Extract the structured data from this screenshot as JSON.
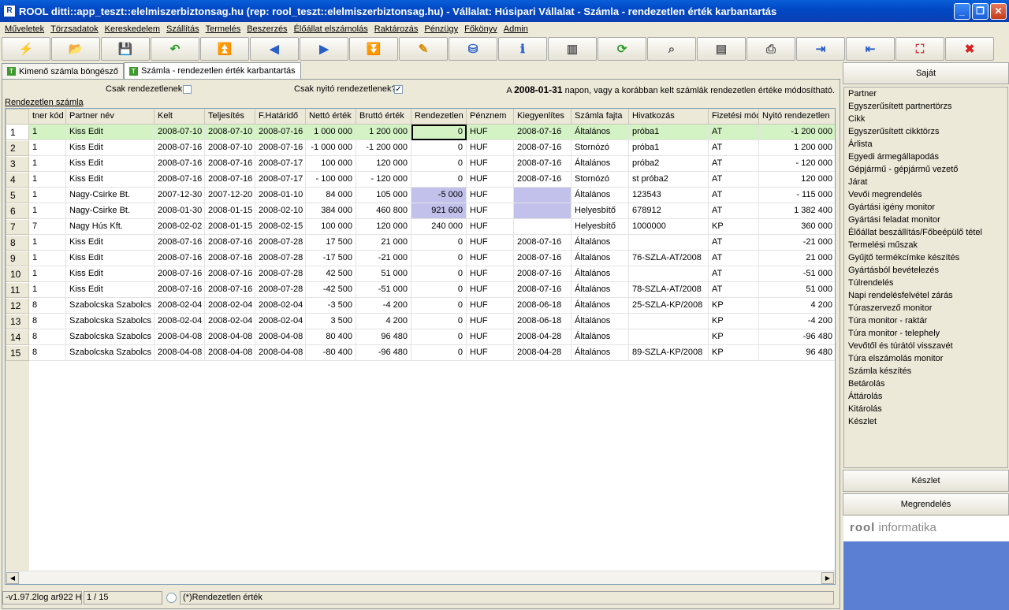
{
  "window": {
    "title": "ROOL ditti::app_teszt::elelmiszerbiztonsag.hu (rep: rool_teszt::elelmiszerbiztonsag.hu) - Vállalat: Húsipari Vállalat - Számla - rendezetlen érték karbantartás",
    "minimize": "_",
    "restore": "❐",
    "close": "✕"
  },
  "menu": [
    "Műveletek",
    "Törzsadatok",
    "Kereskedelem",
    "Szállítás",
    "Termelés",
    "Beszerzés",
    "Élőállat elszámolás",
    "Raktározás",
    "Pénzügy",
    "Főkönyv",
    "Admin"
  ],
  "toolbar": [
    {
      "icon": "lightning-icon",
      "glyph": "⚡",
      "color": "#d8a400"
    },
    {
      "icon": "open-folder-icon",
      "glyph": "📂",
      "color": "#2a5fc8"
    },
    {
      "icon": "save-icon",
      "glyph": "💾",
      "color": "#2a5fc8"
    },
    {
      "icon": "undo-icon",
      "glyph": "↶",
      "color": "#2e9b2e"
    },
    {
      "icon": "first-record-icon",
      "glyph": "⏫",
      "color": "#2a5fc8"
    },
    {
      "icon": "previous-record-icon",
      "glyph": "◀",
      "color": "#2a5fc8"
    },
    {
      "icon": "next-record-icon",
      "glyph": "▶",
      "color": "#2a5fc8"
    },
    {
      "icon": "last-record-icon",
      "glyph": "⏬",
      "color": "#2a5fc8"
    },
    {
      "icon": "edit-icon",
      "glyph": "✎",
      "color": "#d88a00"
    },
    {
      "icon": "database-icon",
      "glyph": "⛁",
      "color": "#2a5fc8"
    },
    {
      "icon": "info-icon",
      "glyph": "ℹ",
      "color": "#2a5fc8"
    },
    {
      "icon": "form-view-icon",
      "glyph": "▥",
      "color": "#555555"
    },
    {
      "icon": "refresh-icon",
      "glyph": "⟳",
      "color": "#2e9b2e"
    },
    {
      "icon": "search-icon",
      "glyph": "⌕",
      "color": "#555555"
    },
    {
      "icon": "columns-icon",
      "glyph": "▤",
      "color": "#555555"
    },
    {
      "icon": "print-icon",
      "glyph": "⎙",
      "color": "#555555"
    },
    {
      "icon": "export-icon",
      "glyph": "⇥",
      "color": "#2a5fc8"
    },
    {
      "icon": "import-icon",
      "glyph": "⇤",
      "color": "#2a5fc8"
    },
    {
      "icon": "fullscreen-icon",
      "glyph": "⛶",
      "color": "#c83232"
    },
    {
      "icon": "cancel-icon",
      "glyph": "✖",
      "color": "#d82020"
    }
  ],
  "tabs": [
    {
      "label": "Kimenő számla böngésző",
      "icon_text": "T"
    },
    {
      "label": "Számla - rendezetlen érték karbantartás",
      "icon_text": "T"
    }
  ],
  "filters": {
    "only_unsettled_label": "Csak rendezetlenek",
    "only_unsettled_checked": false,
    "only_opening_label": "Csak nyitó rendezetlenek?",
    "only_opening_checked": true,
    "notice_prefix": "A",
    "notice_date": "2008-01-31",
    "notice_suffix": "napon, vagy a korábban kelt számlák rendezetlen értéke módosítható."
  },
  "grid_title": "Rendezetlen számla",
  "grid": {
    "columns": [
      "tner kód",
      "Partner név",
      "Kelt",
      "Teljesítés",
      "F.Határidő",
      "Nettó érték",
      "Bruttó érték",
      "Rendezetlen",
      "Pénznem",
      "Kiegyenlítes",
      "Számla fajta",
      "Hivatkozás",
      "Fizetési móc",
      "Nyitó rendezetlen"
    ],
    "rows": [
      [
        "1",
        "Kiss Edit",
        "2008-07-10",
        "2008-07-10",
        "2008-07-16",
        "1 000 000",
        "1 200 000",
        "0",
        "HUF",
        "2008-07-16",
        "Általános",
        "próba1",
        "AT",
        "-1 200 000"
      ],
      [
        "1",
        "Kiss Edit",
        "2008-07-16",
        "2008-07-10",
        "2008-07-16",
        "-1 000 000",
        "-1 200 000",
        "0",
        "HUF",
        "2008-07-16",
        "Stornózó",
        "próba1",
        "AT",
        "1 200 000"
      ],
      [
        "1",
        "Kiss Edit",
        "2008-07-16",
        "2008-07-16",
        "2008-07-17",
        "100 000",
        "120 000",
        "0",
        "HUF",
        "2008-07-16",
        "Általános",
        "próba2",
        "AT",
        "- 120 000"
      ],
      [
        "1",
        "Kiss Edit",
        "2008-07-16",
        "2008-07-16",
        "2008-07-17",
        "- 100 000",
        "- 120 000",
        "0",
        "HUF",
        "2008-07-16",
        "Stornózó",
        "st próba2",
        "AT",
        "120 000"
      ],
      [
        "1",
        "Nagy-Csirke Bt.",
        "2007-12-30",
        "2007-12-20",
        "2008-01-10",
        "84 000",
        "105 000",
        "-5 000",
        "HUF",
        "",
        "Általános",
        "123543",
        "AT",
        "- 115 000"
      ],
      [
        "1",
        "Nagy-Csirke Bt.",
        "2008-01-30",
        "2008-01-15",
        "2008-02-10",
        "384 000",
        "460 800",
        "921 600",
        "HUF",
        "",
        "Helyesbítő",
        "678912",
        "AT",
        "1 382 400"
      ],
      [
        "7",
        "Nagy Hús Kft.",
        "2008-02-02",
        "2008-01-15",
        "2008-02-15",
        "100 000",
        "120 000",
        "240 000",
        "HUF",
        "",
        "Helyesbítő",
        "1000000",
        "KP",
        "360 000"
      ],
      [
        "1",
        "Kiss Edit",
        "2008-07-16",
        "2008-07-16",
        "2008-07-28",
        "17 500",
        "21 000",
        "0",
        "HUF",
        "2008-07-16",
        "Általános",
        "",
        "AT",
        "-21 000"
      ],
      [
        "1",
        "Kiss Edit",
        "2008-07-16",
        "2008-07-16",
        "2008-07-28",
        "-17 500",
        "-21 000",
        "0",
        "HUF",
        "2008-07-16",
        "Általános",
        "76-SZLA-AT/2008",
        "AT",
        "21 000"
      ],
      [
        "1",
        "Kiss Edit",
        "2008-07-16",
        "2008-07-16",
        "2008-07-28",
        "42 500",
        "51 000",
        "0",
        "HUF",
        "2008-07-16",
        "Általános",
        "",
        "AT",
        "-51 000"
      ],
      [
        "1",
        "Kiss Edit",
        "2008-07-16",
        "2008-07-16",
        "2008-07-28",
        "-42 500",
        "-51 000",
        "0",
        "HUF",
        "2008-07-16",
        "Általános",
        "78-SZLA-AT/2008",
        "AT",
        "51 000"
      ],
      [
        "8",
        "Szabolcska Szabolcs",
        "2008-02-04",
        "2008-02-04",
        "2008-02-04",
        "-3 500",
        "-4 200",
        "0",
        "HUF",
        "2008-06-18",
        "Általános",
        "25-SZLA-KP/2008",
        "KP",
        "4 200"
      ],
      [
        "8",
        "Szabolcska Szabolcs",
        "2008-02-04",
        "2008-02-04",
        "2008-02-04",
        "3 500",
        "4 200",
        "0",
        "HUF",
        "2008-06-18",
        "Általános",
        "",
        "KP",
        "-4 200"
      ],
      [
        "8",
        "Szabolcska Szabolcs",
        "2008-04-08",
        "2008-04-08",
        "2008-04-08",
        "80 400",
        "96 480",
        "0",
        "HUF",
        "2008-04-28",
        "Általános",
        "",
        "KP",
        "-96 480"
      ],
      [
        "8",
        "Szabolcska Szabolcs",
        "2008-04-08",
        "2008-04-08",
        "2008-04-08",
        "-80 400",
        "-96 480",
        "0",
        "HUF",
        "2008-04-28",
        "Általános",
        "89-SZLA-KP/2008",
        "KP",
        "96 480"
      ]
    ]
  },
  "status": {
    "version": "-v1.97.2log ar922 H",
    "record": "1 / 15",
    "field_label": "(*)Rendezetlen érték"
  },
  "right_panel": {
    "own_button": "Saját",
    "items": [
      "Partner",
      "Egyszerűsített partnertörzs",
      "Cikk",
      "Egyszerűsített cikktörzs",
      "Árlista",
      "Egyedi ármegállapodás",
      "Gépjármű - gépjármű vezető",
      "Járat",
      "Vevői megrendelés",
      "Gyártási igény monitor",
      "Gyártási feladat monitor",
      "Élőállat beszállítás/Főbeépülő tétel",
      "Termelési műszak",
      "Gyűjtő termékcímke készítés",
      "Gyártásból bevételezés",
      "Túlrendelés",
      "Napi rendelésfelvétel zárás",
      "Túraszervező monitor",
      "Túra monitor - raktár",
      "Túra monitor - telephely",
      "Vevőtől és túrától visszavét",
      "Túra elszámolás monitor",
      "Számla készítés",
      "Betárolás",
      "Áttárolás",
      "Kitárolás",
      "Készlet"
    ],
    "stock_button": "Készlet",
    "order_button": "Megrendelés",
    "logo_brand": "rool",
    "logo_text": "informatika"
  },
  "colors": {
    "selected_row": "#d4f3c5",
    "highlight_cell": "#c1c1ec",
    "titlebar": "#0149c7"
  }
}
